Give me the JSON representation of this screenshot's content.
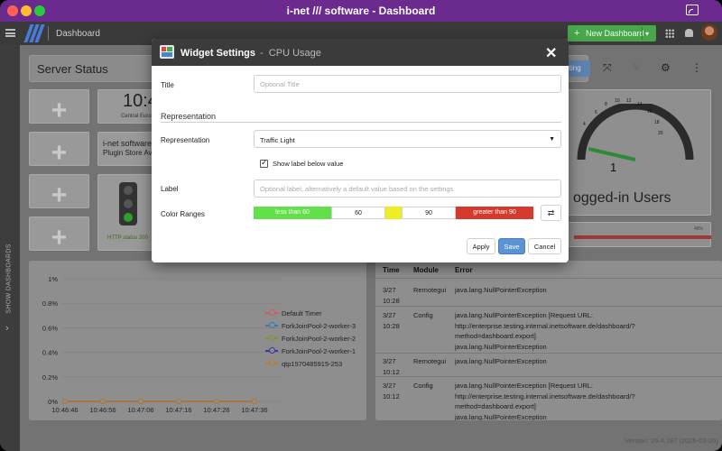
{
  "window": {
    "title": "i-net /// software - Dashboard"
  },
  "header": {
    "app_name": "Dashboard",
    "new_dashboard_label": "New Dashboard"
  },
  "sidebar": {
    "show_dashboards_label": "SHOW DASHBOARDS"
  },
  "dashboard": {
    "title": "Server Status",
    "clock": {
      "time": "10:4",
      "caption": "Central Euro"
    },
    "plugin_store": {
      "line1": "i-net software",
      "line2": "Plugin Store Ava"
    },
    "http_status": "HTTP status 200",
    "editing_label": "iting",
    "gauge": {
      "ticks": [
        "4",
        "6",
        "8",
        "10",
        "12",
        "14",
        "16",
        "18",
        "20"
      ],
      "value": "1",
      "label": "ogged-in Users"
    },
    "redbar_label": "48%",
    "version": "Version: 26.4.187 (2026-03-26)"
  },
  "chart_data": {
    "type": "line",
    "y_ticks": [
      "1%",
      "0.8%",
      "0.6%",
      "0.4%",
      "0.2%",
      "0%"
    ],
    "ylim": [
      0,
      1
    ],
    "x": [
      "10:46:46",
      "10:46:56",
      "10:47:06",
      "10:47:16",
      "10:47:26",
      "10:47:36"
    ],
    "series": [
      {
        "name": "Default Timer",
        "color": "#d05a5a",
        "values": [
          0,
          0,
          0,
          0,
          0,
          0
        ]
      },
      {
        "name": "ForkJoinPool-2-worker-3",
        "color": "#3a78b0",
        "values": [
          0,
          0,
          0,
          0,
          0,
          0
        ]
      },
      {
        "name": "ForkJoinPool-2-worker-2",
        "color": "#7a9a2a",
        "values": [
          0,
          0,
          0,
          0,
          0,
          0
        ]
      },
      {
        "name": "ForkJoinPool-2-worker-1",
        "color": "#3a3a9a",
        "values": [
          0,
          0,
          0,
          0,
          0,
          0
        ]
      },
      {
        "name": "qtp1570485915-253",
        "color": "#c07a2a",
        "values": [
          0,
          0,
          0,
          0,
          0,
          0
        ]
      }
    ]
  },
  "error_table": {
    "headers": [
      "Time",
      "Module",
      "Error"
    ],
    "rows": [
      {
        "time": "3/27\n10:28",
        "module": "Remotegui",
        "error": "java.lang.NullPointerException"
      },
      {
        "time": "3/27\n10:28",
        "module": "Config",
        "error": "java.lang.NullPointerException [Request URL:\nhttp://enterprise.testing.internal.inetsoftware.de/dashboard/?\nmethod=dashboard.export]\njava.lang.NullPointerException"
      },
      {
        "time": "3/27\n10:12",
        "module": "Remotegui",
        "error": "java.lang.NullPointerException"
      },
      {
        "time": "3/27\n10:12",
        "module": "Config",
        "error": "java.lang.NullPointerException [Request URL:\nhttp://enterprise.testing.internal.inetsoftware.de/dashboard/?\nmethod=dashboard.export]\njava.lang.NullPointerException"
      }
    ]
  },
  "modal": {
    "title": "Widget Settings",
    "subtitle_sep": "-",
    "subtitle": "CPU Usage",
    "title_label": "Title",
    "title_placeholder": "Optional Title",
    "title_value": "",
    "section_representation": "Representation",
    "representation_label": "Representation",
    "representation_value": "Traffic Light",
    "show_label_checkbox": "Show label below value",
    "show_label_checked": true,
    "label_label": "Label",
    "label_placeholder": "Optional label, alternatively a default value based on the settings",
    "color_ranges_label": "Color Ranges",
    "ranges": {
      "low_label": "less than 60",
      "threshold1": "60",
      "threshold2": "90",
      "high_label": "greater than 90",
      "colors": {
        "low": "#62e049",
        "mid": "#eeee22",
        "high": "#d63a2c"
      }
    },
    "buttons": {
      "apply": "Apply",
      "save": "Save",
      "cancel": "Cancel"
    }
  }
}
